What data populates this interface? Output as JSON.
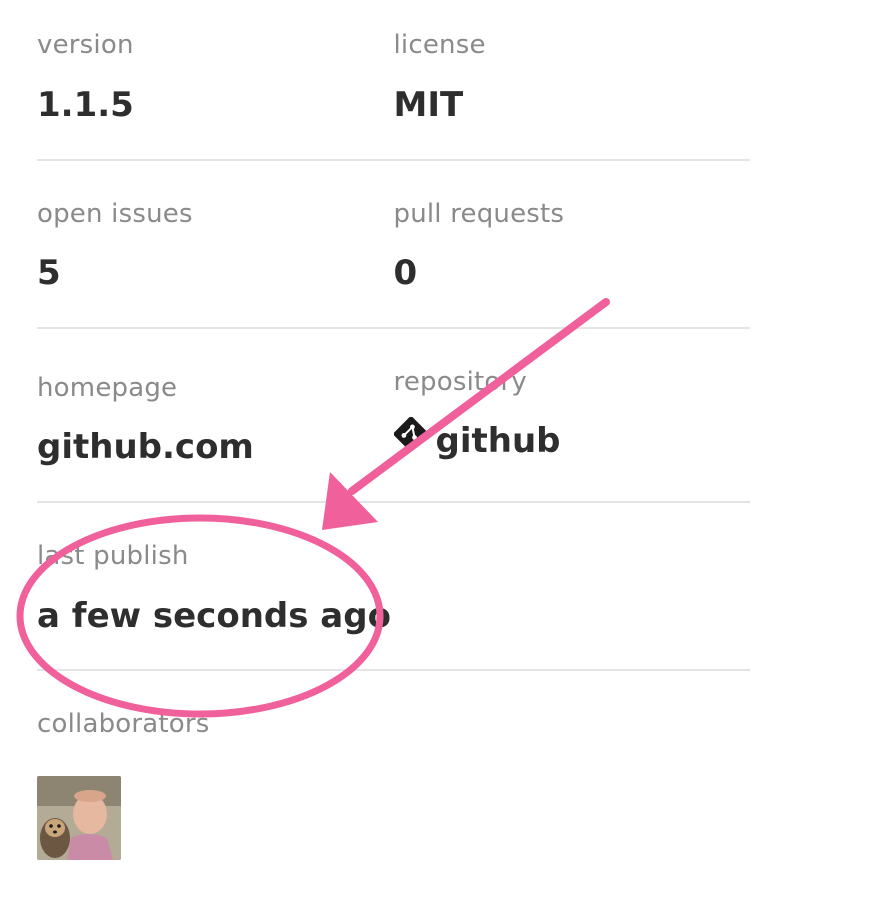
{
  "meta": {
    "version_label": "version",
    "version_value": "1.1.5",
    "license_label": "license",
    "license_value": "MIT",
    "open_issues_label": "open issues",
    "open_issues_value": "5",
    "pull_requests_label": "pull requests",
    "pull_requests_value": "0",
    "homepage_label": "homepage",
    "homepage_value": "github.com",
    "repository_label": "repository",
    "repository_value": "github",
    "last_publish_label": "last publish",
    "last_publish_value": "a few seconds ago",
    "collaborators_label": "collaborators"
  },
  "icons": {
    "repository": "git-icon"
  },
  "colors": {
    "annotation": "#f0609a",
    "label": "#8a8a8a",
    "value": "#2e2e2e",
    "divider": "#e4e4e4"
  }
}
